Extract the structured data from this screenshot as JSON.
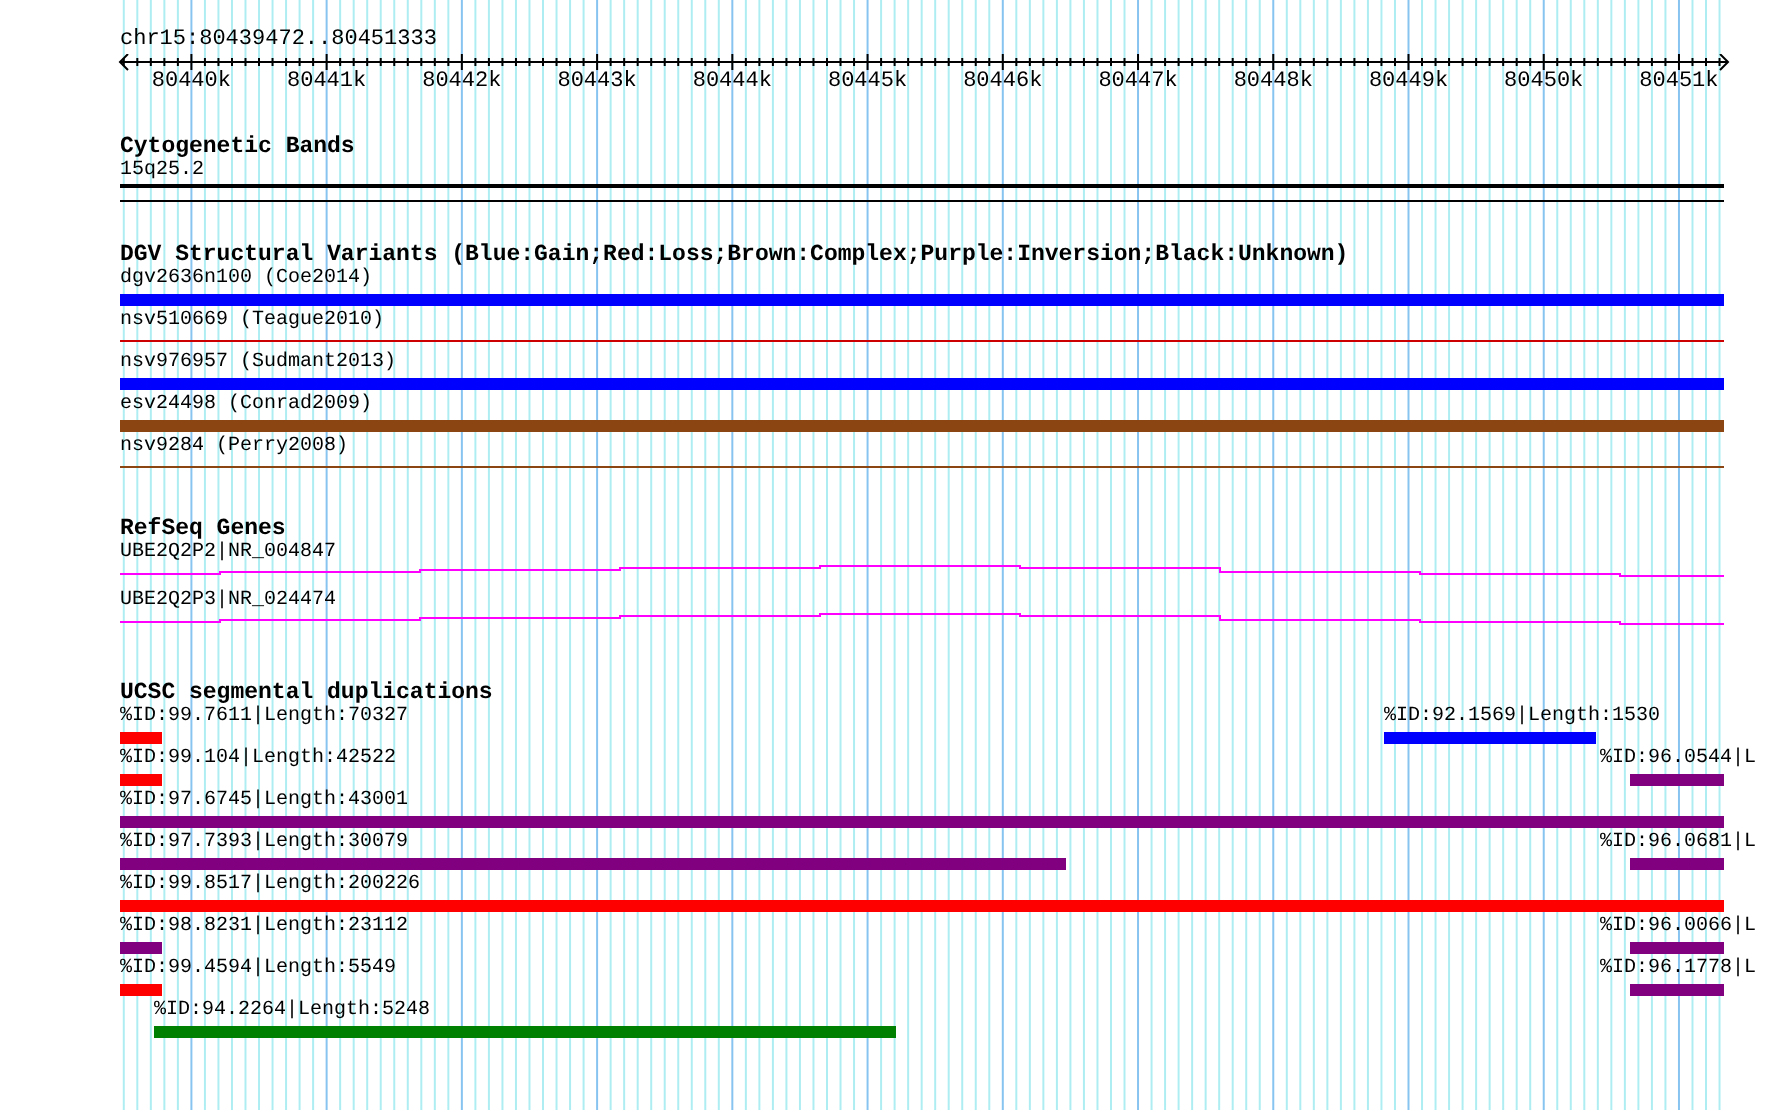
{
  "ruler": {
    "location": "chr15:80439472..80451333",
    "tick_labels": [
      "80440k",
      "80441k",
      "80442k",
      "80443k",
      "80444k",
      "80445k",
      "80446k",
      "80447k",
      "80448k",
      "80449k",
      "80450k",
      "80451k"
    ]
  },
  "tracks": [
    {
      "kind": "cytoband",
      "title": "Cytogenetic Bands",
      "features": [
        {
          "label": "15q25.2"
        }
      ]
    },
    {
      "kind": "variants",
      "title": "DGV Structural Variants (Blue:Gain;Red:Loss;Brown:Complex;Purple:Inversion;Black:Unknown)",
      "features": [
        {
          "label": "dgv2636n100 (Coe2014)",
          "kind": "thick",
          "color": "#0000ff"
        },
        {
          "label": "nsv510669 (Teague2010)",
          "kind": "thin",
          "color": "#cc0000"
        },
        {
          "label": "nsv976957 (Sudmant2013)",
          "kind": "thick",
          "color": "#0000ff"
        },
        {
          "label": "esv24498 (Conrad2009)",
          "kind": "thick",
          "color": "#8b4513"
        },
        {
          "label": "nsv9284 (Perry2008)",
          "kind": "thin",
          "color": "#8b4513"
        }
      ]
    },
    {
      "kind": "genes",
      "title": "RefSeq Genes",
      "features": [
        {
          "label": "UBE2Q2P2|NR_004847",
          "color": "#ff00ff"
        },
        {
          "label": "UBE2Q2P3|NR_024474",
          "color": "#ff00ff"
        }
      ]
    },
    {
      "kind": "segdups",
      "title": "UCSC segmental duplications",
      "rows": [
        {
          "features": [
            {
              "label": "%ID:99.7611|Length:70327",
              "color": "#ff0000"
            },
            {
              "label": "%ID:92.1569|Length:1530",
              "color": "#0000ff"
            }
          ]
        },
        {
          "features": [
            {
              "label": "%ID:99.104|Length:42522",
              "color": "#ff0000"
            },
            {
              "label": "%ID:96.0544|L",
              "color": "#800080"
            }
          ]
        },
        {
          "features": [
            {
              "label": "%ID:97.6745|Length:43001",
              "color": "#800080"
            }
          ]
        },
        {
          "features": [
            {
              "label": "%ID:97.7393|Length:30079",
              "color": "#800080"
            },
            {
              "label": "%ID:96.0681|L",
              "color": "#800080"
            }
          ]
        },
        {
          "features": [
            {
              "label": "%ID:99.8517|Length:200226",
              "color": "#ff0000"
            }
          ]
        },
        {
          "features": [
            {
              "label": "%ID:98.8231|Length:23112",
              "color": "#800080"
            },
            {
              "label": "%ID:96.0066|L",
              "color": "#800080"
            }
          ]
        },
        {
          "features": [
            {
              "label": "%ID:99.4594|Length:5549",
              "color": "#ff0000"
            },
            {
              "label": "%ID:96.1778|L",
              "color": "#800080"
            }
          ]
        },
        {
          "features": [
            {
              "label": "%ID:94.2264|Length:5248",
              "color": "#008000"
            }
          ]
        }
      ]
    }
  ]
}
